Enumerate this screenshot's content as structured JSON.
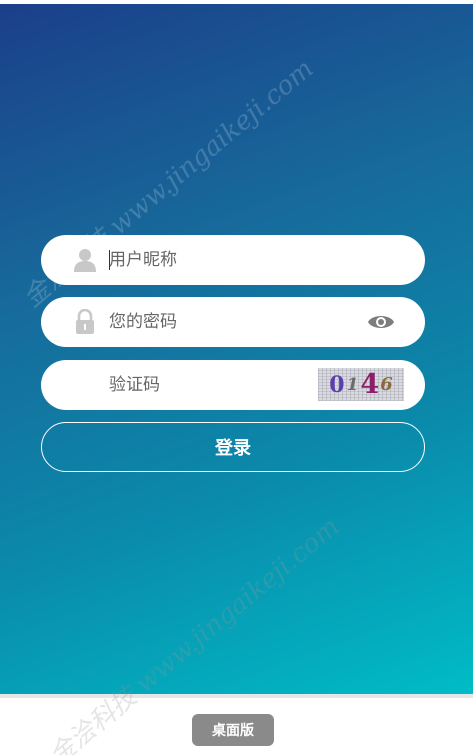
{
  "watermark": {
    "text": "金浍科技 www.jingaikeji.com"
  },
  "login_form": {
    "username": {
      "placeholder": "用户昵称",
      "value": "",
      "icon": "user-icon"
    },
    "password": {
      "placeholder": "您的密码",
      "value": "",
      "icon": "lock-icon",
      "toggle_icon": "eye-icon"
    },
    "captcha": {
      "placeholder": "验证码",
      "value": "",
      "image_chars": [
        "0",
        "1",
        "4",
        "6"
      ]
    },
    "submit_label": "登录"
  },
  "footer": {
    "desktop_label": "桌面版"
  },
  "colors": {
    "gradient_start": "#1b3f8a",
    "gradient_end": "#00bcc6",
    "desktop_button": "#8a8a8a"
  }
}
